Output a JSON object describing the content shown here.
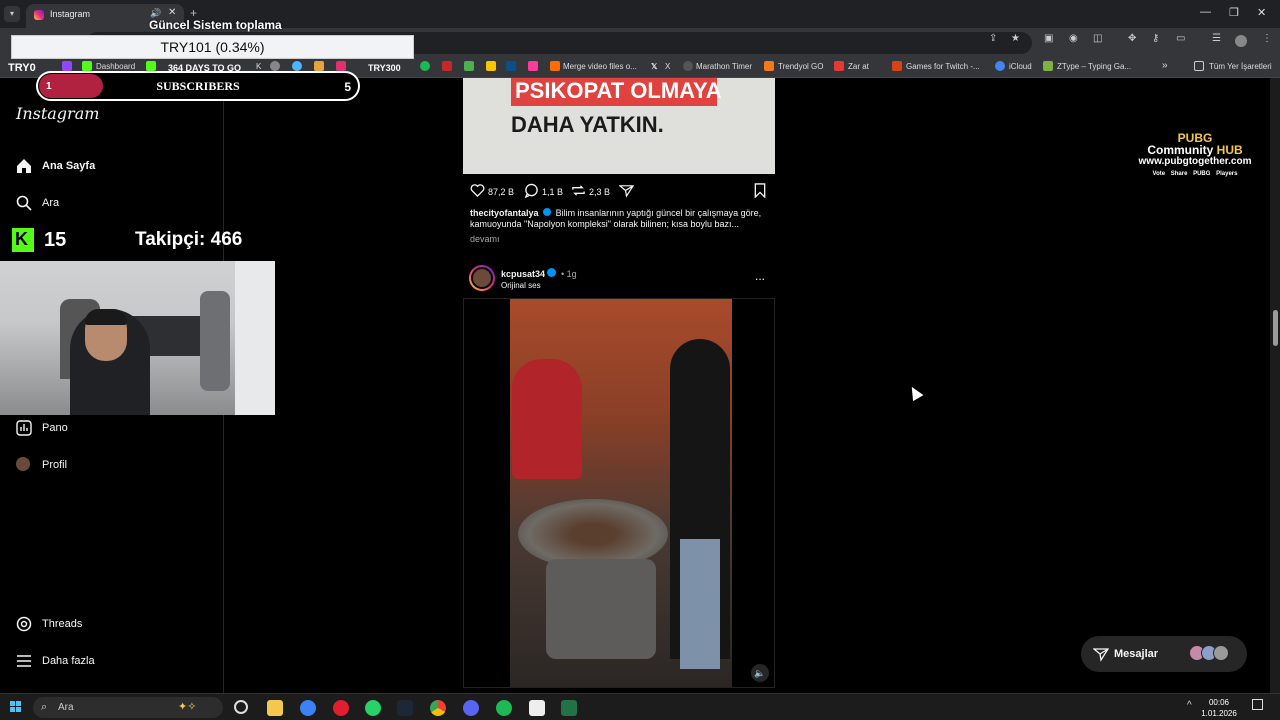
{
  "browser": {
    "tab_title": "Instagram",
    "bookmarks": [
      {
        "label": "Dashboard"
      },
      {
        "label": "K"
      },
      {
        "label": "Merge video files o..."
      },
      {
        "label": "X"
      },
      {
        "label": "Marathon Timer"
      },
      {
        "label": "Trendyol GO"
      },
      {
        "label": "Zar at"
      },
      {
        "label": "Games for Twitch -..."
      },
      {
        "label": "iCloud"
      },
      {
        "label": "ZType – Typing Ga..."
      },
      {
        "label": "»"
      },
      {
        "label": "Tüm Yer İşaretleri"
      }
    ]
  },
  "overlay": {
    "system_title": "Güncel Sistem toplama",
    "ticker_text": "TRY101 (0.34%)",
    "ticker_left": "TRY0",
    "days_text": "364 DAYS TO GO",
    "try300": "TRY300",
    "subscribers_label": "SUBSCRIBERS",
    "subscribers_current": "1",
    "subscribers_goal": "5",
    "subscribers_progress": 0.2,
    "kick_count": "15",
    "followers_text": "Takipçi: 466",
    "pubg": {
      "line1": "PUBG",
      "line2a": "Community",
      "line2b": "HUB",
      "line3": "www.pubgtogether.com",
      "line4": "Vote Share PUBG Players"
    }
  },
  "instagram": {
    "logo": "Instagram",
    "nav": [
      {
        "label": "Ana Sayfa",
        "icon": "home-icon"
      },
      {
        "label": "Ara",
        "icon": "search-icon"
      },
      {
        "label": "Pano",
        "icon": "chart-icon"
      },
      {
        "label": "Profil",
        "icon": "profile-icon"
      },
      {
        "label": "Threads",
        "icon": "threads-icon"
      },
      {
        "label": "Daha fazla",
        "icon": "menu-icon"
      }
    ],
    "post1": {
      "image_line1": "PSIKOPAT OLMAYA",
      "image_line2": "DAHA YATKIN.",
      "likes": "87,2 B",
      "comments": "1,1 B",
      "reposts": "2,3 B",
      "username": "thecityofantalya",
      "caption": "Bilim insanlarının yaptığı güncel bir çalışmaya göre, kamuoyunda \"Napolyon kompleksi\" olarak bilinen; kısa boylu bazı...",
      "more_label": "devamı"
    },
    "post2": {
      "username": "kcpusat34",
      "time": "• 1g",
      "audio": "Orijinal ses",
      "menu": "..."
    },
    "messages_label": "Mesajlar"
  },
  "taskbar": {
    "search_placeholder": "Ara",
    "time": "00:06",
    "date": "1.01.2026"
  },
  "colors": {
    "background": "#000000",
    "accent_blue": "#0095f6",
    "kick_green": "#53fc18",
    "subs_fill": "#b0223f",
    "pubg_yellow": "#f2c94c"
  }
}
